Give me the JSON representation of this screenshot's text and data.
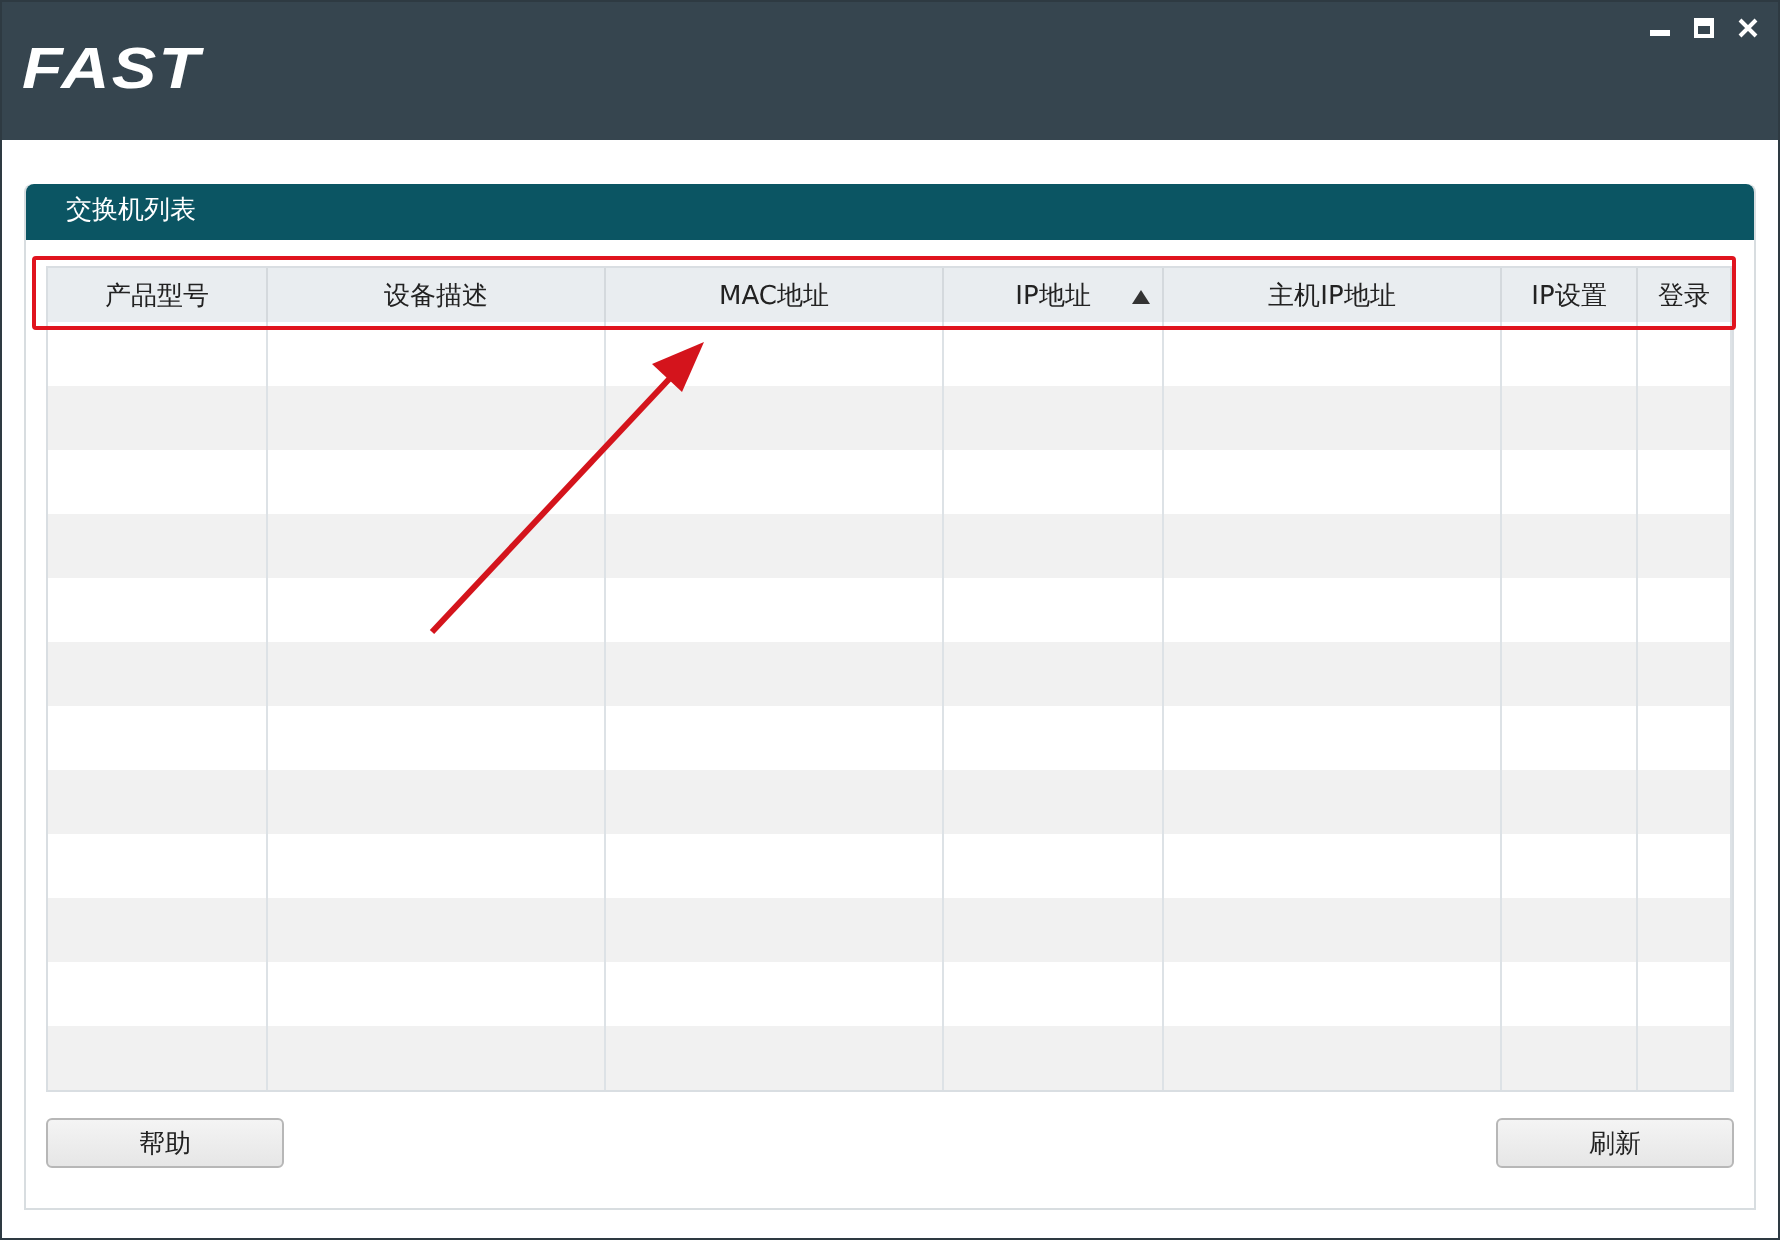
{
  "window": {
    "logo": "FAST"
  },
  "panel": {
    "title": "交换机列表"
  },
  "table": {
    "columns": [
      {
        "label": "产品型号",
        "sorted": false
      },
      {
        "label": "设备描述",
        "sorted": false
      },
      {
        "label": "MAC地址",
        "sorted": false
      },
      {
        "label": "IP地址",
        "sorted": true
      },
      {
        "label": "主机IP地址",
        "sorted": false
      },
      {
        "label": "IP设置",
        "sorted": false
      },
      {
        "label": "登录",
        "sorted": false
      }
    ]
  },
  "buttons": [
    {
      "label": "帮助"
    },
    {
      "label": "刷新"
    }
  ]
}
